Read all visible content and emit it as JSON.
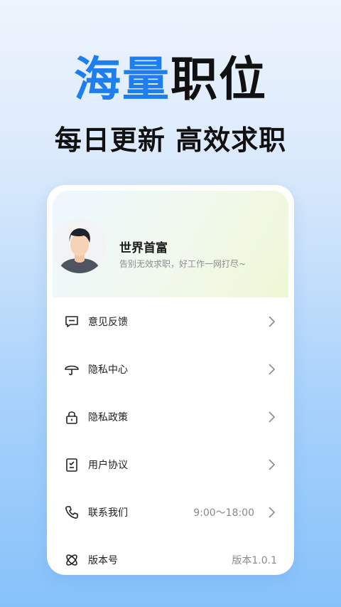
{
  "hero": {
    "title_blue": "海量",
    "title_black": "职位",
    "subtitle": "每日更新 高效求职"
  },
  "profile": {
    "name": "世界首富",
    "bio": "告别无效求职，好工作一网打尽~"
  },
  "menu": [
    {
      "label": "意见反馈",
      "icon": "feedback-icon",
      "value": "",
      "arrow": true
    },
    {
      "label": "隐私中心",
      "icon": "umbrella-icon",
      "value": "",
      "arrow": true
    },
    {
      "label": "隐私政策",
      "icon": "lock-icon",
      "value": "",
      "arrow": true
    },
    {
      "label": "用户协议",
      "icon": "clipboard-icon",
      "value": "",
      "arrow": true
    },
    {
      "label": "联系我们",
      "icon": "phone-icon",
      "value": "9:00～18:00",
      "arrow": true
    },
    {
      "label": "版本号",
      "icon": "version-icon",
      "value": "版本1.0.1",
      "arrow": false
    }
  ],
  "colors": {
    "accent": "#1e7ef0",
    "text": "#222222",
    "muted": "#8a8a8a"
  }
}
